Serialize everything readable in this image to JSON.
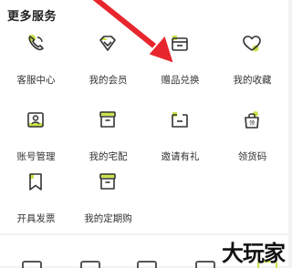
{
  "section": {
    "title": "更多服务"
  },
  "services": [
    {
      "label": "客服中心",
      "icon": "phone-icon"
    },
    {
      "label": "我的会员",
      "icon": "diamond-icon"
    },
    {
      "label": "赠品兑换",
      "icon": "gift-box-icon"
    },
    {
      "label": "我的收藏",
      "icon": "heart-icon"
    },
    {
      "label": "账号管理",
      "icon": "id-card-icon"
    },
    {
      "label": "我的宅配",
      "icon": "delivery-box-icon"
    },
    {
      "label": "邀请有礼",
      "icon": "invite-box-icon"
    },
    {
      "label": "领货码",
      "icon": "shopping-bag-icon"
    },
    {
      "label": "开具发票",
      "icon": "bookmark-icon"
    },
    {
      "label": "我的定期购",
      "icon": "subscription-box-icon"
    }
  ],
  "watermark": {
    "text": "大玩家"
  },
  "colors": {
    "accent": "#c8e44a",
    "icon_stroke": "#333333",
    "arrow": "#e8262d"
  }
}
